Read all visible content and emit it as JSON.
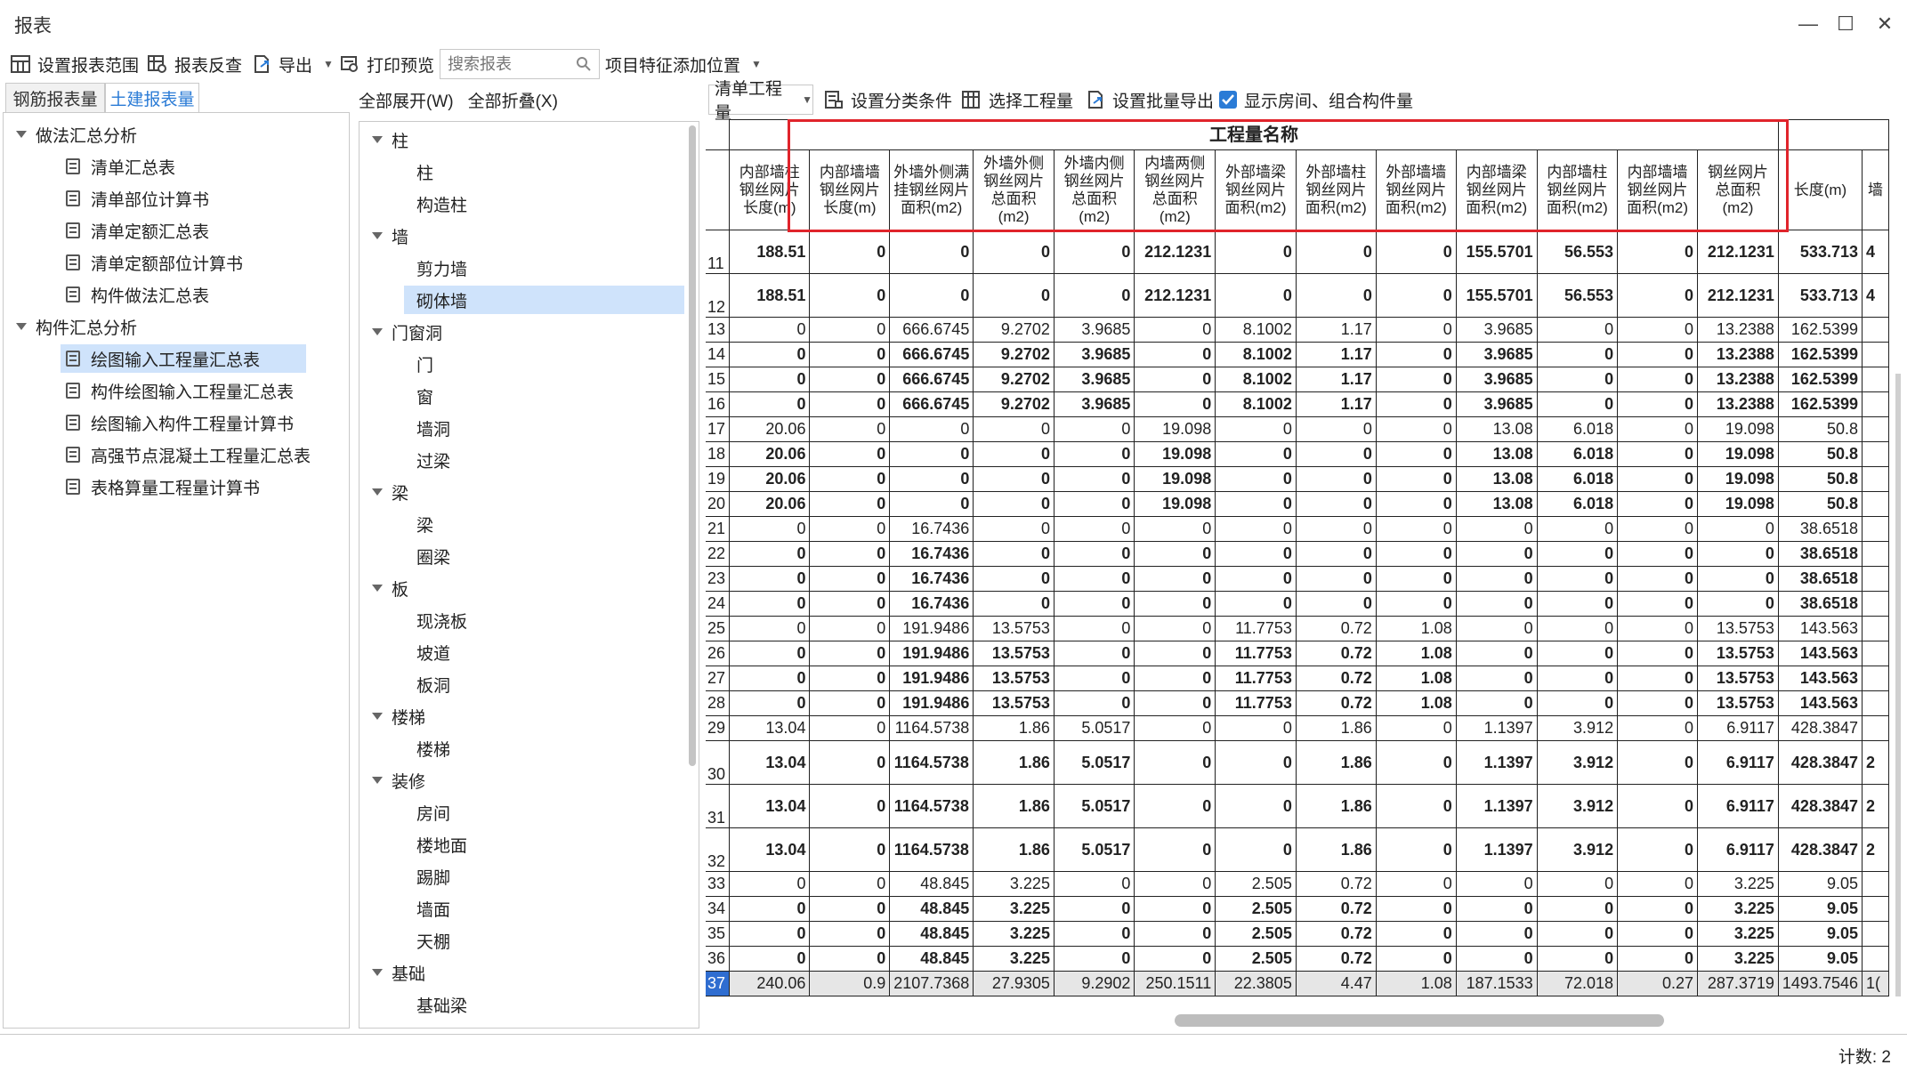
{
  "window": {
    "title": "报表",
    "minimize": "—",
    "maximize": "☐",
    "close": "✕"
  },
  "toolbar": {
    "set_range": "设置报表范围",
    "reverse_check": "报表反查",
    "export": "导出",
    "print_preview": "打印预览",
    "search_placeholder": "搜索报表",
    "feature_position": "项目特征添加位置"
  },
  "tabs": {
    "rebar": "钢筋报表量",
    "civil": "土建报表量"
  },
  "left_tree": {
    "group1": "做法汇总分析",
    "group1_items": [
      "清单汇总表",
      "清单部位计算书",
      "清单定额汇总表",
      "清单定额部位计算书",
      "构件做法汇总表"
    ],
    "group2": "构件汇总分析",
    "group2_items": [
      "绘图输入工程量汇总表",
      "构件绘图输入工程量汇总表",
      "绘图输入构件工程量计算书",
      "高强节点混凝土工程量汇总表",
      "表格算量工程量计算书"
    ]
  },
  "mid_panel": {
    "expand_all": "全部展开(W)",
    "collapse_all": "全部折叠(X)",
    "tree": [
      {
        "label": "柱",
        "children": [
          "柱",
          "构造柱"
        ]
      },
      {
        "label": "墙",
        "children": [
          "剪力墙",
          "砌体墙"
        ]
      },
      {
        "label": "门窗洞",
        "children": [
          "门",
          "窗",
          "墙洞",
          "过梁"
        ]
      },
      {
        "label": "梁",
        "children": [
          "梁",
          "圈梁"
        ]
      },
      {
        "label": "板",
        "children": [
          "现浇板",
          "坡道",
          "板洞"
        ]
      },
      {
        "label": "楼梯",
        "children": [
          "楼梯"
        ]
      },
      {
        "label": "装修",
        "children": [
          "房间",
          "楼地面",
          "踢脚",
          "墙面",
          "天棚"
        ]
      },
      {
        "label": "基础",
        "children": [
          "基础梁"
        ]
      }
    ]
  },
  "right_toolbar": {
    "quantity_select": "清单工程量",
    "set_classify": "设置分类条件",
    "select_quantity": "选择工程量",
    "batch_export": "设置批量导出",
    "show_rooms": "显示房间、组合构件量",
    "show_rooms_checked": true
  },
  "table": {
    "group_header": "工程量名称",
    "columns": [
      "内部墙柱钢丝网片长度(m)",
      "内部墙墙钢丝网片长度(m)",
      "外墙外侧满挂钢丝网片面积(m2)",
      "外墙外侧钢丝网片总面积(m2)",
      "外墙内侧钢丝网片总面积(m2)",
      "内墙两侧钢丝网片总面积(m2)",
      "外部墙梁钢丝网片面积(m2)",
      "外部墙柱钢丝网片面积(m2)",
      "外部墙墙钢丝网片面积(m2)",
      "内部墙梁钢丝网片面积(m2)",
      "内部墙柱钢丝网片面积(m2)",
      "内部墙墙钢丝网片面积(m2)",
      "钢丝网片总面积(m2)",
      "长度(m)",
      "墙"
    ],
    "rows": [
      {
        "n": "11",
        "b": true,
        "tall": 2,
        "v": [
          "188.51",
          "0",
          "0",
          "0",
          "0",
          "212.1231",
          "0",
          "0",
          "0",
          "155.5701",
          "56.553",
          "0",
          "212.1231",
          "533.713",
          "4"
        ]
      },
      {
        "n": "12",
        "b": true,
        "tall": 2,
        "v": [
          "188.51",
          "0",
          "0",
          "0",
          "0",
          "212.1231",
          "0",
          "0",
          "0",
          "155.5701",
          "56.553",
          "0",
          "212.1231",
          "533.713",
          "4"
        ]
      },
      {
        "n": "13",
        "b": false,
        "tall": 1,
        "v": [
          "0",
          "0",
          "666.6745",
          "9.2702",
          "3.9685",
          "0",
          "8.1002",
          "1.17",
          "0",
          "3.9685",
          "0",
          "0",
          "13.2388",
          "162.5399",
          ""
        ]
      },
      {
        "n": "14",
        "b": true,
        "tall": 1,
        "v": [
          "0",
          "0",
          "666.6745",
          "9.2702",
          "3.9685",
          "0",
          "8.1002",
          "1.17",
          "0",
          "3.9685",
          "0",
          "0",
          "13.2388",
          "162.5399",
          ""
        ]
      },
      {
        "n": "15",
        "b": true,
        "tall": 1,
        "v": [
          "0",
          "0",
          "666.6745",
          "9.2702",
          "3.9685",
          "0",
          "8.1002",
          "1.17",
          "0",
          "3.9685",
          "0",
          "0",
          "13.2388",
          "162.5399",
          ""
        ]
      },
      {
        "n": "16",
        "b": true,
        "tall": 1,
        "v": [
          "0",
          "0",
          "666.6745",
          "9.2702",
          "3.9685",
          "0",
          "8.1002",
          "1.17",
          "0",
          "3.9685",
          "0",
          "0",
          "13.2388",
          "162.5399",
          ""
        ]
      },
      {
        "n": "17",
        "b": false,
        "tall": 1,
        "v": [
          "20.06",
          "0",
          "0",
          "0",
          "0",
          "19.098",
          "0",
          "0",
          "0",
          "13.08",
          "6.018",
          "0",
          "19.098",
          "50.8",
          ""
        ]
      },
      {
        "n": "18",
        "b": true,
        "tall": 1,
        "v": [
          "20.06",
          "0",
          "0",
          "0",
          "0",
          "19.098",
          "0",
          "0",
          "0",
          "13.08",
          "6.018",
          "0",
          "19.098",
          "50.8",
          ""
        ]
      },
      {
        "n": "19",
        "b": true,
        "tall": 1,
        "v": [
          "20.06",
          "0",
          "0",
          "0",
          "0",
          "19.098",
          "0",
          "0",
          "0",
          "13.08",
          "6.018",
          "0",
          "19.098",
          "50.8",
          ""
        ]
      },
      {
        "n": "20",
        "b": true,
        "tall": 1,
        "v": [
          "20.06",
          "0",
          "0",
          "0",
          "0",
          "19.098",
          "0",
          "0",
          "0",
          "13.08",
          "6.018",
          "0",
          "19.098",
          "50.8",
          ""
        ]
      },
      {
        "n": "21",
        "b": false,
        "tall": 1,
        "v": [
          "0",
          "0",
          "16.7436",
          "0",
          "0",
          "0",
          "0",
          "0",
          "0",
          "0",
          "0",
          "0",
          "0",
          "38.6518",
          ""
        ]
      },
      {
        "n": "22",
        "b": true,
        "tall": 1,
        "v": [
          "0",
          "0",
          "16.7436",
          "0",
          "0",
          "0",
          "0",
          "0",
          "0",
          "0",
          "0",
          "0",
          "0",
          "38.6518",
          ""
        ]
      },
      {
        "n": "23",
        "b": true,
        "tall": 1,
        "v": [
          "0",
          "0",
          "16.7436",
          "0",
          "0",
          "0",
          "0",
          "0",
          "0",
          "0",
          "0",
          "0",
          "0",
          "38.6518",
          ""
        ]
      },
      {
        "n": "24",
        "b": true,
        "tall": 1,
        "v": [
          "0",
          "0",
          "16.7436",
          "0",
          "0",
          "0",
          "0",
          "0",
          "0",
          "0",
          "0",
          "0",
          "0",
          "38.6518",
          ""
        ]
      },
      {
        "n": "25",
        "b": false,
        "tall": 1,
        "v": [
          "0",
          "0",
          "191.9486",
          "13.5753",
          "0",
          "0",
          "11.7753",
          "0.72",
          "1.08",
          "0",
          "0",
          "0",
          "13.5753",
          "143.563",
          ""
        ]
      },
      {
        "n": "26",
        "b": true,
        "tall": 1,
        "v": [
          "0",
          "0",
          "191.9486",
          "13.5753",
          "0",
          "0",
          "11.7753",
          "0.72",
          "1.08",
          "0",
          "0",
          "0",
          "13.5753",
          "143.563",
          ""
        ]
      },
      {
        "n": "27",
        "b": true,
        "tall": 1,
        "v": [
          "0",
          "0",
          "191.9486",
          "13.5753",
          "0",
          "0",
          "11.7753",
          "0.72",
          "1.08",
          "0",
          "0",
          "0",
          "13.5753",
          "143.563",
          ""
        ]
      },
      {
        "n": "28",
        "b": true,
        "tall": 1,
        "v": [
          "0",
          "0",
          "191.9486",
          "13.5753",
          "0",
          "0",
          "11.7753",
          "0.72",
          "1.08",
          "0",
          "0",
          "0",
          "13.5753",
          "143.563",
          ""
        ]
      },
      {
        "n": "29",
        "b": false,
        "tall": 1,
        "v": [
          "13.04",
          "0",
          "1164.5738",
          "1.86",
          "5.0517",
          "0",
          "0",
          "1.86",
          "0",
          "1.1397",
          "3.912",
          "0",
          "6.9117",
          "428.3847",
          ""
        ]
      },
      {
        "n": "30",
        "b": true,
        "tall": 2,
        "v": [
          "13.04",
          "0",
          "1164.5738",
          "1.86",
          "5.0517",
          "0",
          "0",
          "1.86",
          "0",
          "1.1397",
          "3.912",
          "0",
          "6.9117",
          "428.3847",
          "2"
        ]
      },
      {
        "n": "31",
        "b": true,
        "tall": 2,
        "v": [
          "13.04",
          "0",
          "1164.5738",
          "1.86",
          "5.0517",
          "0",
          "0",
          "1.86",
          "0",
          "1.1397",
          "3.912",
          "0",
          "6.9117",
          "428.3847",
          "2"
        ]
      },
      {
        "n": "32",
        "b": true,
        "tall": 2,
        "v": [
          "13.04",
          "0",
          "1164.5738",
          "1.86",
          "5.0517",
          "0",
          "0",
          "1.86",
          "0",
          "1.1397",
          "3.912",
          "0",
          "6.9117",
          "428.3847",
          "2"
        ]
      },
      {
        "n": "33",
        "b": false,
        "tall": 1,
        "v": [
          "0",
          "0",
          "48.845",
          "3.225",
          "0",
          "0",
          "2.505",
          "0.72",
          "0",
          "0",
          "0",
          "0",
          "3.225",
          "9.05",
          ""
        ]
      },
      {
        "n": "34",
        "b": true,
        "tall": 1,
        "v": [
          "0",
          "0",
          "48.845",
          "3.225",
          "0",
          "0",
          "2.505",
          "0.72",
          "0",
          "0",
          "0",
          "0",
          "3.225",
          "9.05",
          ""
        ]
      },
      {
        "n": "35",
        "b": true,
        "tall": 1,
        "v": [
          "0",
          "0",
          "48.845",
          "3.225",
          "0",
          "0",
          "2.505",
          "0.72",
          "0",
          "0",
          "0",
          "0",
          "3.225",
          "9.05",
          ""
        ]
      },
      {
        "n": "36",
        "b": true,
        "tall": 1,
        "v": [
          "0",
          "0",
          "48.845",
          "3.225",
          "0",
          "0",
          "2.505",
          "0.72",
          "0",
          "0",
          "0",
          "0",
          "3.225",
          "9.05",
          ""
        ]
      },
      {
        "n": "37",
        "b": false,
        "tall": 1,
        "total": true,
        "v": [
          "240.06",
          "0.9",
          "2107.7368",
          "27.9305",
          "9.2902",
          "250.1511",
          "22.3805",
          "4.47",
          "1.08",
          "187.1533",
          "72.018",
          "0.27",
          "287.3719",
          "1493.7546",
          "1("
        ]
      }
    ]
  },
  "status": {
    "count": "计数: 2"
  },
  "colors": {
    "accent": "#2a7bd6",
    "highlight": "#e0242b",
    "selected": "#cfe3fb"
  }
}
